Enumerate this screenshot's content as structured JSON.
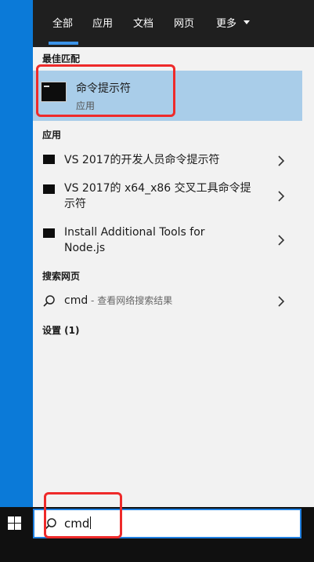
{
  "tabs": [
    "全部",
    "应用",
    "文档",
    "网页",
    "更多"
  ],
  "sections": {
    "best_match": "最佳匹配",
    "apps": "应用",
    "web": "搜索网页",
    "settings": "设置 (1)"
  },
  "best_match": {
    "title": "命令提示符",
    "subtitle": "应用"
  },
  "apps": [
    {
      "line1": "VS 2017的开发人员命令提示符",
      "line2": ""
    },
    {
      "line1": "VS 2017的 x64_x86 交叉工具命令提",
      "line2": "示符"
    },
    {
      "line1": "Install Additional Tools for",
      "line2": "Node.js"
    }
  ],
  "web": {
    "query": "cmd",
    "hint": " - 查看网络搜索结果"
  },
  "search": {
    "value": "cmd"
  },
  "colors": {
    "accent": "#1f7fe0",
    "highlight": "#a9cde9",
    "annotation": "#ee2a2a"
  },
  "icons": {
    "terminal": "cmd-icon",
    "search": "search-icon",
    "chevron": "chevron-right-icon",
    "windows": "windows-logo-icon"
  }
}
